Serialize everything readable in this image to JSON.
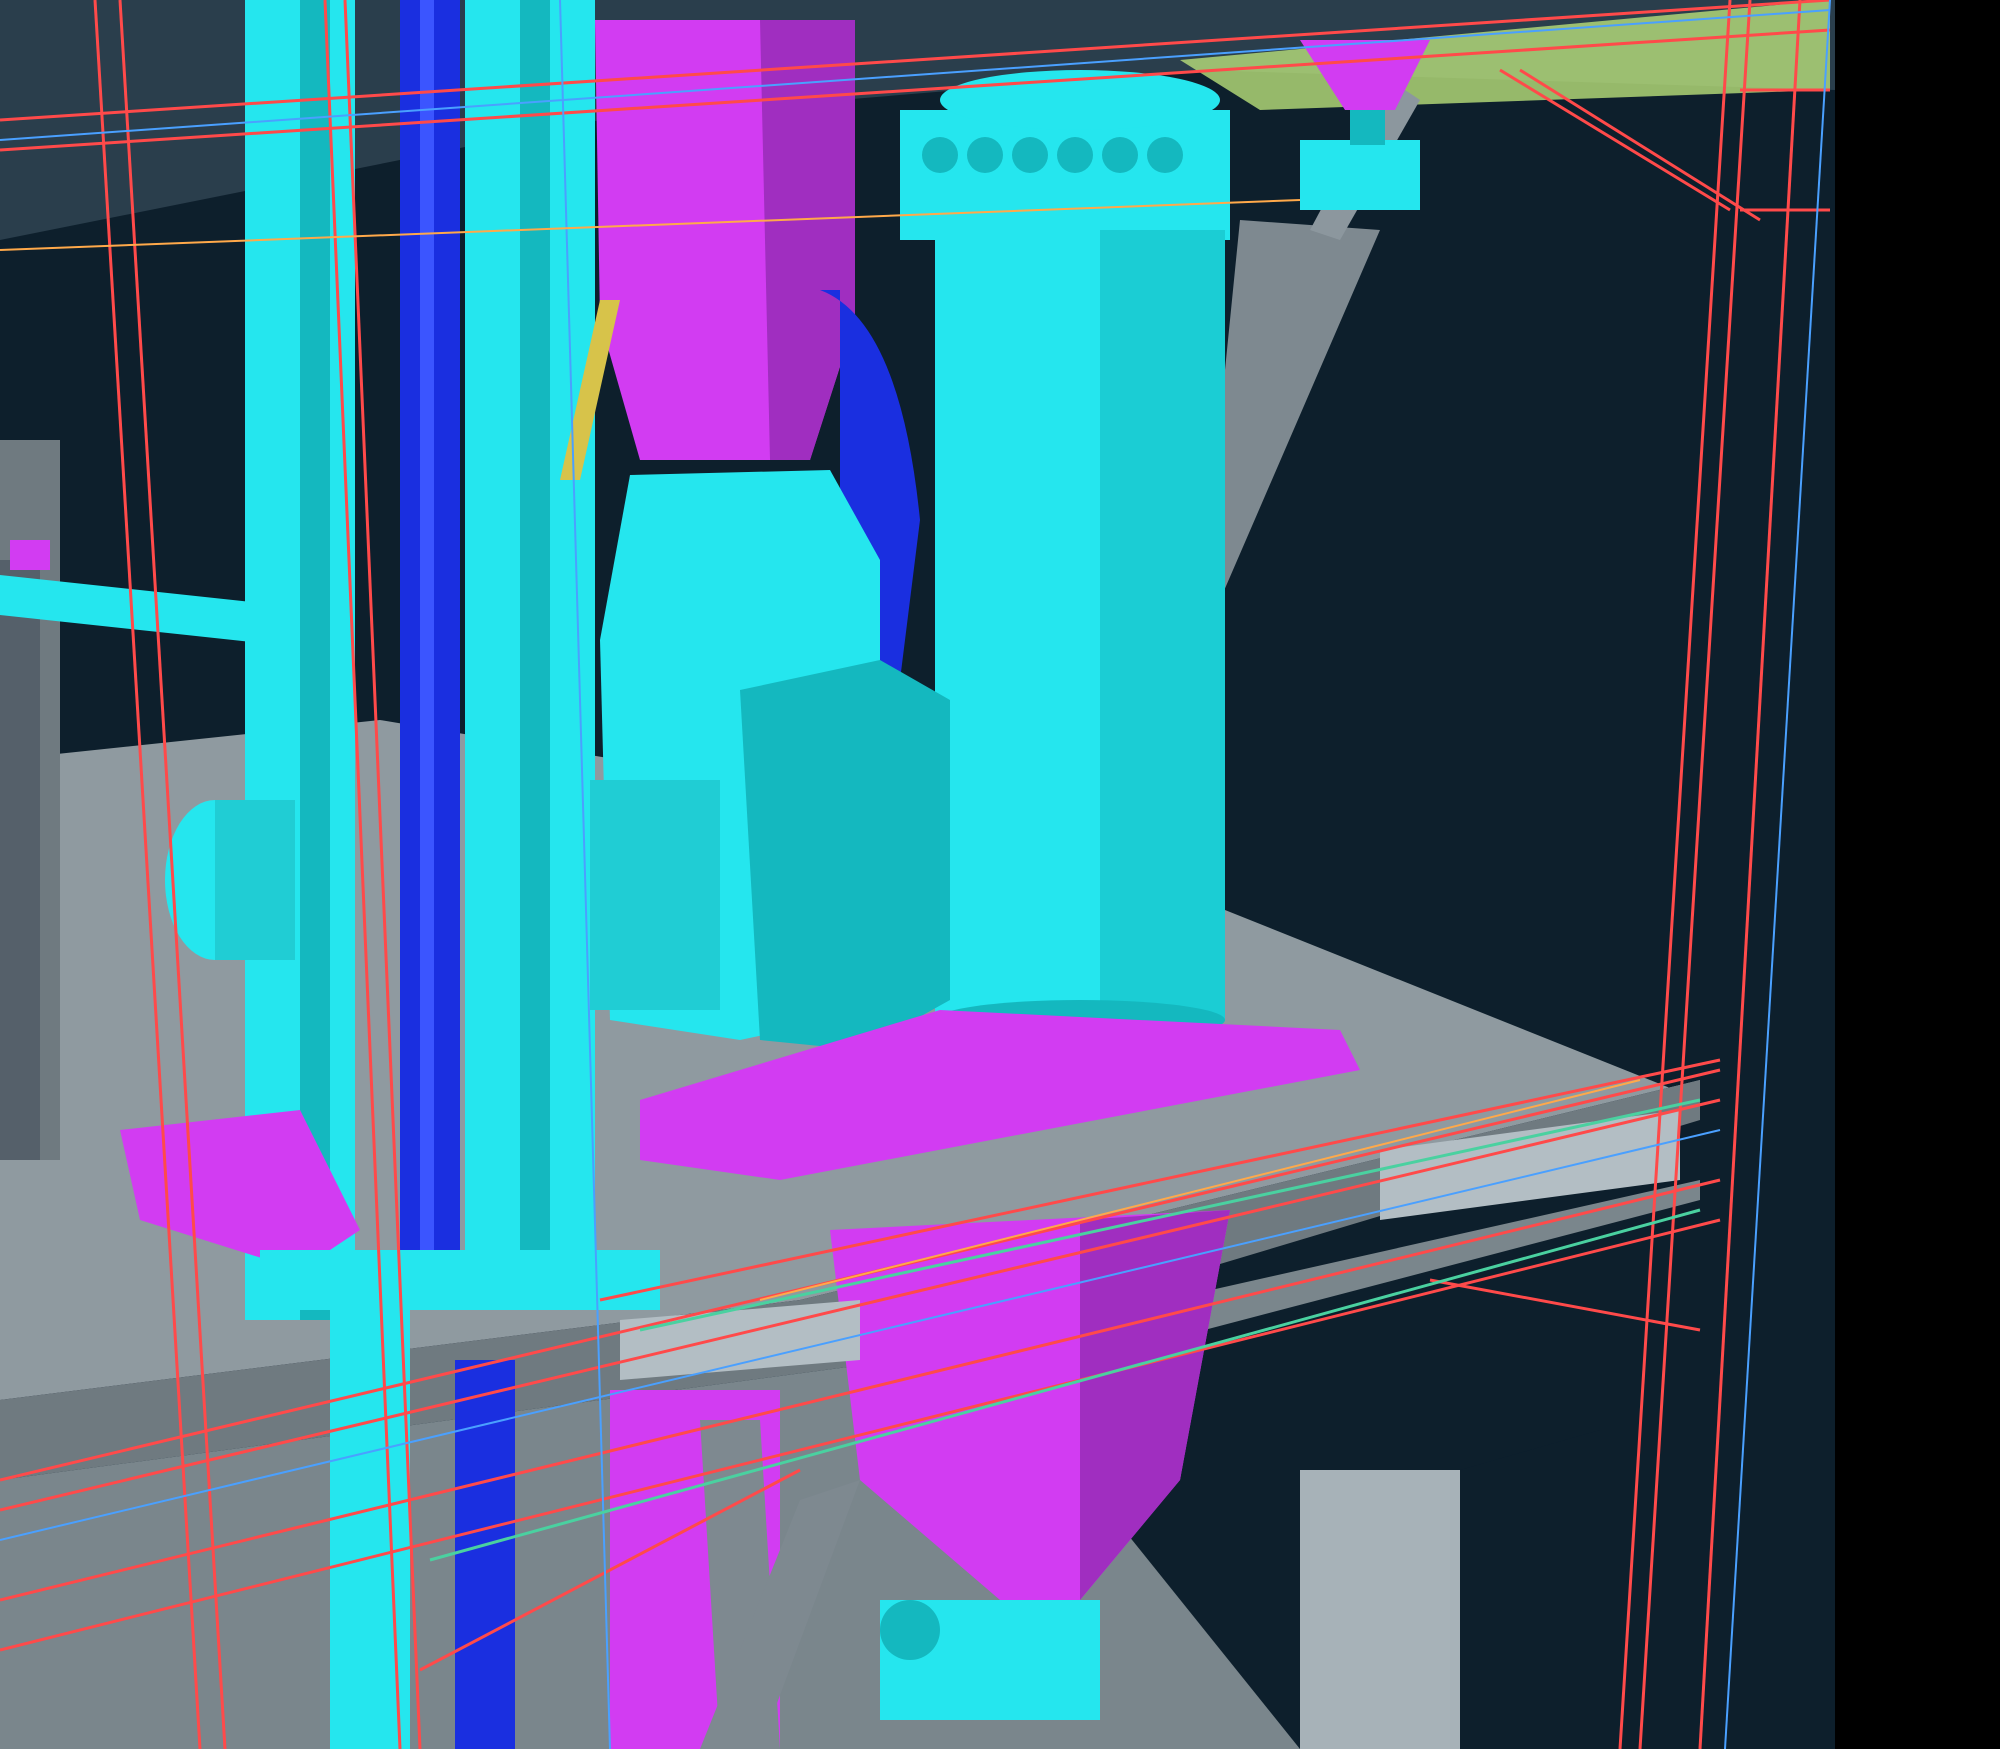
{
  "viewport": {
    "kind": "3D plant model viewport (no visible text)"
  },
  "colors": {
    "background": "#000000",
    "sky": "#0d1f2c",
    "floor": "#8f9aa0",
    "floor_dark": "#6f7a80",
    "equipment": "#25e6ee",
    "equipment_shade": "#14b8bf",
    "chute": "#d23cf2",
    "chute_shade": "#a02ec0",
    "pipe_blue": "#1a2fe0",
    "structure_gray": "#9aa6ad",
    "frame_red": "#ff4a4a",
    "frame_blue": "#4aa0ff"
  }
}
